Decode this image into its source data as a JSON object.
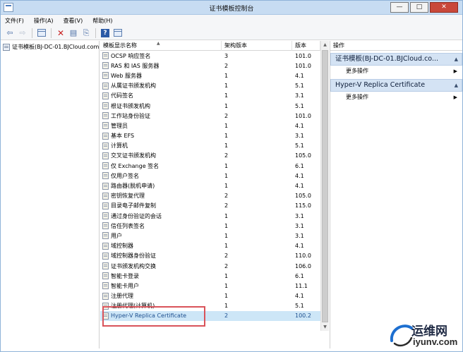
{
  "window": {
    "title": "证书模板控制台"
  },
  "menu": {
    "file": "文件(F)",
    "action": "操作(A)",
    "view": "查看(V)",
    "help": "帮助(H)"
  },
  "tree": {
    "root_label": "证书模板(BJ-DC-01.BJCloud.com)"
  },
  "list": {
    "columns": {
      "name": "模板显示名称",
      "schema": "架构版本",
      "version": "版本"
    },
    "rows": [
      {
        "name": "OCSP 响应签名",
        "schema": "3",
        "version": "101.0"
      },
      {
        "name": "RAS 和 IAS 服务器",
        "schema": "2",
        "version": "101.0"
      },
      {
        "name": "Web 服务器",
        "schema": "1",
        "version": "4.1"
      },
      {
        "name": "从属证书颁发机构",
        "schema": "1",
        "version": "5.1"
      },
      {
        "name": "代码签名",
        "schema": "1",
        "version": "3.1"
      },
      {
        "name": "根证书颁发机构",
        "schema": "1",
        "version": "5.1"
      },
      {
        "name": "工作站身份验证",
        "schema": "2",
        "version": "101.0"
      },
      {
        "name": "管理员",
        "schema": "1",
        "version": "4.1"
      },
      {
        "name": "基本 EFS",
        "schema": "1",
        "version": "3.1"
      },
      {
        "name": "计算机",
        "schema": "1",
        "version": "5.1"
      },
      {
        "name": "交叉证书颁发机构",
        "schema": "2",
        "version": "105.0"
      },
      {
        "name": "仅 Exchange 签名",
        "schema": "1",
        "version": "6.1"
      },
      {
        "name": "仅用户签名",
        "schema": "1",
        "version": "4.1"
      },
      {
        "name": "路由器(脱机申请)",
        "schema": "1",
        "version": "4.1"
      },
      {
        "name": "密钥恢复代理",
        "schema": "2",
        "version": "105.0"
      },
      {
        "name": "目录电子邮件复制",
        "schema": "2",
        "version": "115.0"
      },
      {
        "name": "通过身份验证的会话",
        "schema": "1",
        "version": "3.1"
      },
      {
        "name": "信任列表签名",
        "schema": "1",
        "version": "3.1"
      },
      {
        "name": "用户",
        "schema": "1",
        "version": "3.1"
      },
      {
        "name": "域控制器",
        "schema": "1",
        "version": "4.1"
      },
      {
        "name": "域控制器身份验证",
        "schema": "2",
        "version": "110.0"
      },
      {
        "name": "证书颁发机构交换",
        "schema": "2",
        "version": "106.0"
      },
      {
        "name": "智能卡登录",
        "schema": "1",
        "version": "6.1"
      },
      {
        "name": "智能卡用户",
        "schema": "1",
        "version": "11.1"
      },
      {
        "name": "注册代理",
        "schema": "1",
        "version": "4.1"
      },
      {
        "name": "注册代理(计算机)",
        "schema": "1",
        "version": "5.1"
      },
      {
        "name": "Hyper-V Replica Certificate",
        "schema": "2",
        "version": "100.2",
        "selected": true
      }
    ]
  },
  "actions": {
    "title": "操作",
    "sections": [
      {
        "title": "证书模板(BJ-DC-01.BJCloud.co...",
        "item": "更多操作"
      },
      {
        "title": "Hyper-V Replica Certificate",
        "item": "更多操作"
      }
    ]
  },
  "watermark": {
    "line1": "运维网",
    "line2": "iyunv.com"
  },
  "colors": {
    "selected_row": "#cde6f7",
    "highlight_box": "#d9535a",
    "action_section": "#d4e3f4"
  }
}
